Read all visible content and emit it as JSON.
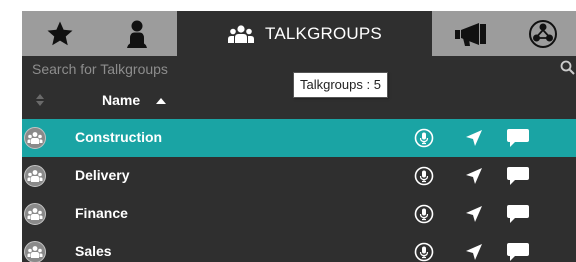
{
  "tabs": [
    {
      "id": "favorites",
      "icon": "star-icon",
      "label": ""
    },
    {
      "id": "contacts",
      "icon": "person-icon",
      "label": ""
    },
    {
      "id": "talkgroups",
      "icon": "group-icon",
      "label": "TALKGROUPS",
      "active": true
    },
    {
      "id": "broadcast",
      "icon": "megaphone-icon",
      "label": ""
    },
    {
      "id": "apps",
      "icon": "network-icon",
      "label": ""
    }
  ],
  "search": {
    "placeholder": "Search for Talkgroups",
    "value": ""
  },
  "tooltip": {
    "text": "Talkgroups : 5"
  },
  "list_header": {
    "name_label": "Name",
    "sort": "ascending"
  },
  "talkgroups": [
    {
      "name": "Construction",
      "selected": true
    },
    {
      "name": "Delivery",
      "selected": false
    },
    {
      "name": "Finance",
      "selected": false
    },
    {
      "name": "Sales",
      "selected": false
    }
  ],
  "colors": {
    "tab_bar": "#9c9c9c",
    "panel": "#2f2f2f",
    "selected_row": "#1aa4a4",
    "text": "#ffffff",
    "placeholder": "#8d8d8d"
  }
}
